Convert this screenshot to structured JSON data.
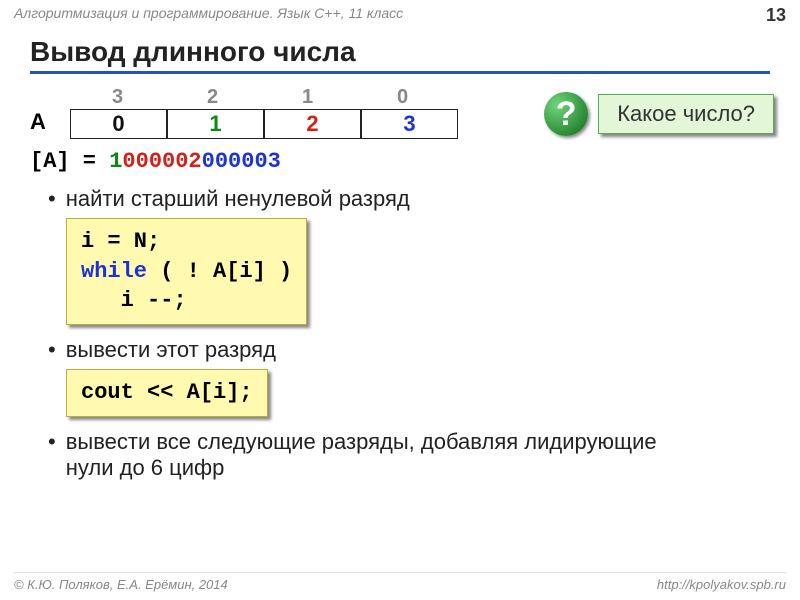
{
  "header": {
    "course": "Алгоритмизация и программирование. Язык C++, 11 класс",
    "page": "13"
  },
  "title": "Вывод длинного числа",
  "array": {
    "label": "A",
    "indices": [
      "3",
      "2",
      "1",
      "0"
    ],
    "cells": [
      {
        "text": "0",
        "class": "c-black"
      },
      {
        "text": "1",
        "class": "c-green"
      },
      {
        "text": "2",
        "class": "c-red"
      },
      {
        "text": "3",
        "class": "c-blue"
      }
    ]
  },
  "expr": {
    "lhs": "[A] = ",
    "parts": [
      {
        "text": "1",
        "class": "c-green"
      },
      {
        "text": "000002",
        "class": "c-red"
      },
      {
        "text": "000003",
        "class": "c-blue"
      }
    ]
  },
  "question": {
    "mark": "?",
    "text": "Какое число?"
  },
  "bullets": {
    "b1": "найти старший ненулевой разряд",
    "b2": "вывести этот разряд",
    "b3": "вывести все следующие разряды, добавляя лидирующие нули до 6 цифр"
  },
  "code1": {
    "l1a": "i = N;",
    "l2kw": "while",
    "l2b": " ( ! A[i] )",
    "l3": "   i --;"
  },
  "code2": {
    "line": "cout << A[i];"
  },
  "footer": {
    "left": "© К.Ю. Поляков, Е.А. Ерёмин, 2014",
    "right": "http://kpolyakov.spb.ru"
  }
}
